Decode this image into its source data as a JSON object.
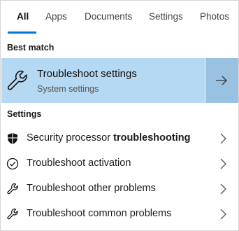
{
  "tabs": [
    {
      "label": "All",
      "active": true
    },
    {
      "label": "Apps",
      "active": false
    },
    {
      "label": "Documents",
      "active": false
    },
    {
      "label": "Settings",
      "active": false
    },
    {
      "label": "Photos",
      "active": false
    }
  ],
  "sections": {
    "best_match": "Best match",
    "settings": "Settings"
  },
  "best_match": {
    "title": "Troubleshoot settings",
    "subtitle": "System settings",
    "icon": "wrench-icon",
    "highlight_color": "#b5d9f2",
    "arrow_color": "#99c2e2"
  },
  "results": [
    {
      "label_plain": "Security processor ",
      "label_bold": "troubleshooting",
      "icon": "shield-icon"
    },
    {
      "label_plain": "Troubleshoot activation",
      "label_bold": "",
      "icon": "check-circle-icon"
    },
    {
      "label_plain": "Troubleshoot other problems",
      "label_bold": "",
      "icon": "wrench-icon"
    },
    {
      "label_plain": "Troubleshoot common problems",
      "label_bold": "",
      "icon": "wrench-icon"
    }
  ],
  "accent_color": "#0078d7"
}
